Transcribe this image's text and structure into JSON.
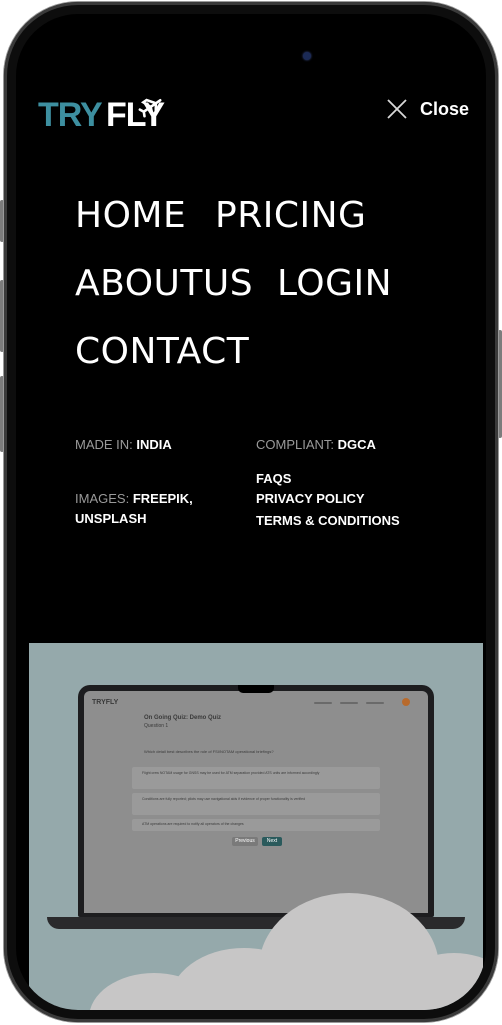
{
  "brand": {
    "logo_text_try": "TRY",
    "logo_text_fly": "FLY"
  },
  "header": {
    "close_label": "Close"
  },
  "nav": {
    "home": "HOME",
    "pricing": "PRICING",
    "about": "ABOUTUS",
    "login": "LOGIN",
    "contact": "CONTACT"
  },
  "info": {
    "made_in_label": "MADE IN:",
    "made_in_value": "INDIA",
    "compliant_label": "COMPLIANT:",
    "compliant_value": "DGCA",
    "images_label": "IMAGES:",
    "images_value_1": "FREEPIK,",
    "images_value_2": "UNSPLASH",
    "links": [
      "FAQS",
      "PRIVACY POLICY",
      "TERMS & CONDITIONS"
    ]
  },
  "preview": {
    "logo": "TRYFLY",
    "title": "On Going Quiz: Demo Quiz",
    "subtitle": "Question 1",
    "question": "Which detail best describes the role of FSI/NOTAM operational briefings?",
    "options": [
      "Flight crew NOTAM usage for GNSS may be used for ATM separation provided ATS units are informed accordingly",
      "Conditions are fully reported; pilots may use navigational aids if evidence of proper functionality is verified",
      "ATM operations are required to notify all operators of the changes"
    ],
    "prev_label": "Previous",
    "next_label": "Next"
  },
  "colors": {
    "background": "#000000",
    "logo_teal": "#3d8fa0",
    "logo_white": "#ffffff",
    "text_muted": "#9a9a9a",
    "preview_bg": "#95a9ab",
    "cloud": "#c7c6c6"
  },
  "icons": {
    "close": "close-icon",
    "airplane": "airplane-icon"
  }
}
